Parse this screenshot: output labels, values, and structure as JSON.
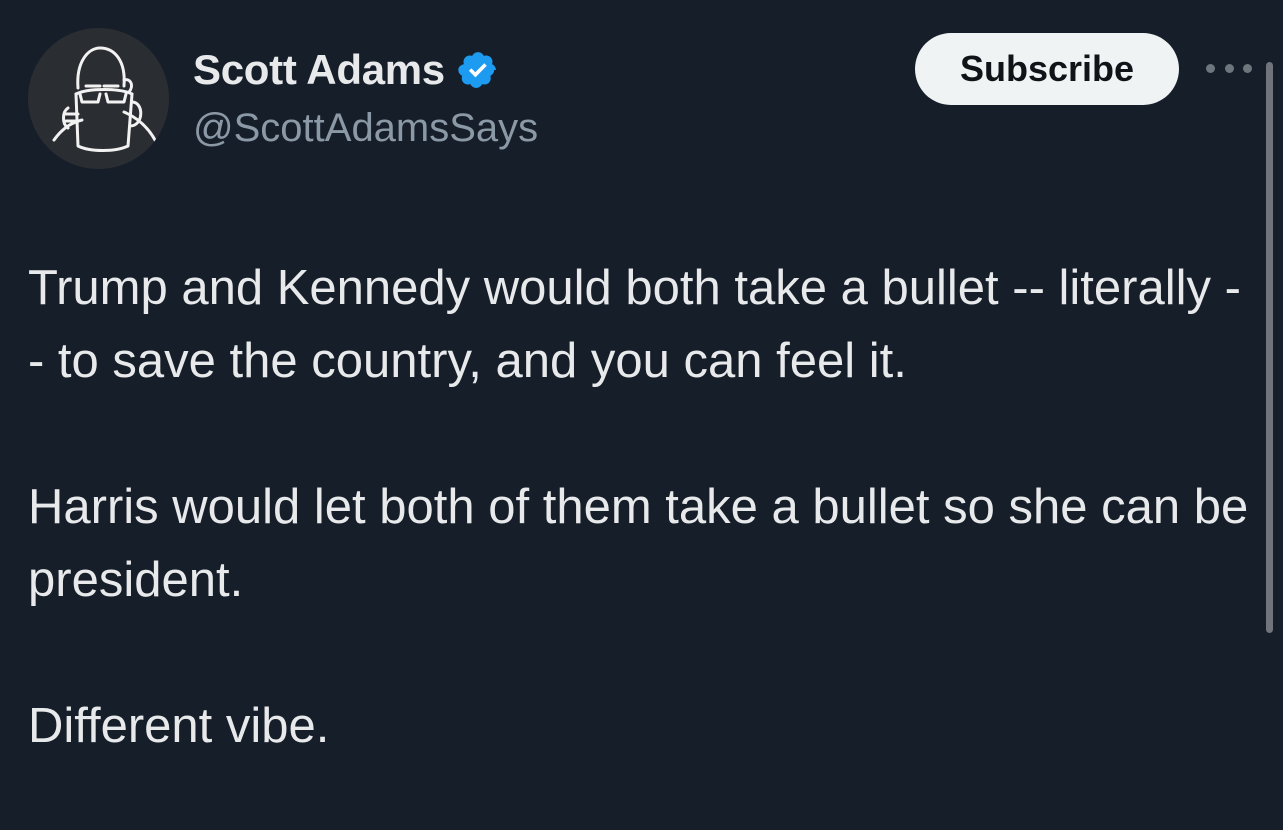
{
  "author": {
    "display_name": "Scott Adams",
    "handle": "@ScottAdamsSays",
    "verified": true,
    "avatar_icon": "man-drinking-from-mug-sketch-icon",
    "verified_icon": "verified-badge-icon"
  },
  "actions": {
    "subscribe_label": "Subscribe",
    "more_icon": "more-options-icon"
  },
  "tweet": {
    "paragraphs": [
      "Trump and Kennedy would both take a bullet -- literally -- to save the country, and you can feel it.",
      "Harris would let both of them take a bullet so she can be president.",
      "Different vibe."
    ]
  },
  "colors": {
    "background": "#161e2a",
    "text_primary": "#e7e9ea",
    "text_secondary": "#8b98a5",
    "verified_blue": "#1d9bf0",
    "button_bg": "#eff3f4",
    "button_text": "#0f1419"
  }
}
